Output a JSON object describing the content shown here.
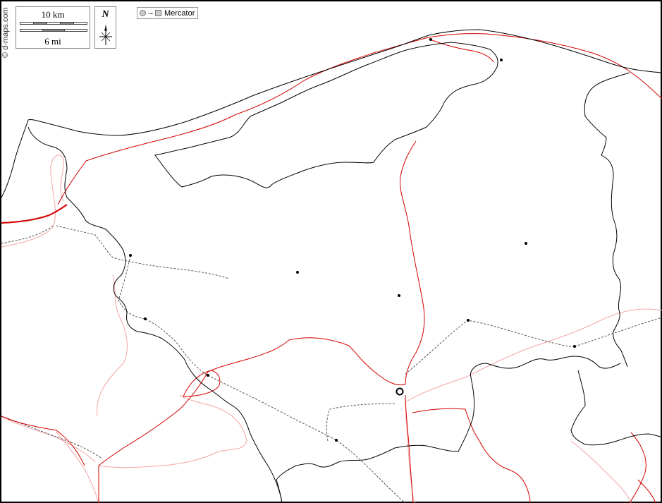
{
  "map": {
    "credit": "© d-maps.com",
    "projection_label": "Mercator",
    "projection_arrow": "→",
    "north_label": "N",
    "scale": {
      "km_label": "10 km",
      "mi_label": "6 mi"
    },
    "colors": {
      "coastline": "#000000",
      "admin_border": "#d40000",
      "admin_border_minor": "#f4a5a5",
      "road_dashed": "#555555",
      "background": "#ffffff",
      "legend_fill": "#cccccc"
    },
    "icons": [
      "north-arrow-icon",
      "projection-circle-icon",
      "projection-square-icon",
      "city-dot-icon",
      "capital-ring-icon"
    ]
  }
}
